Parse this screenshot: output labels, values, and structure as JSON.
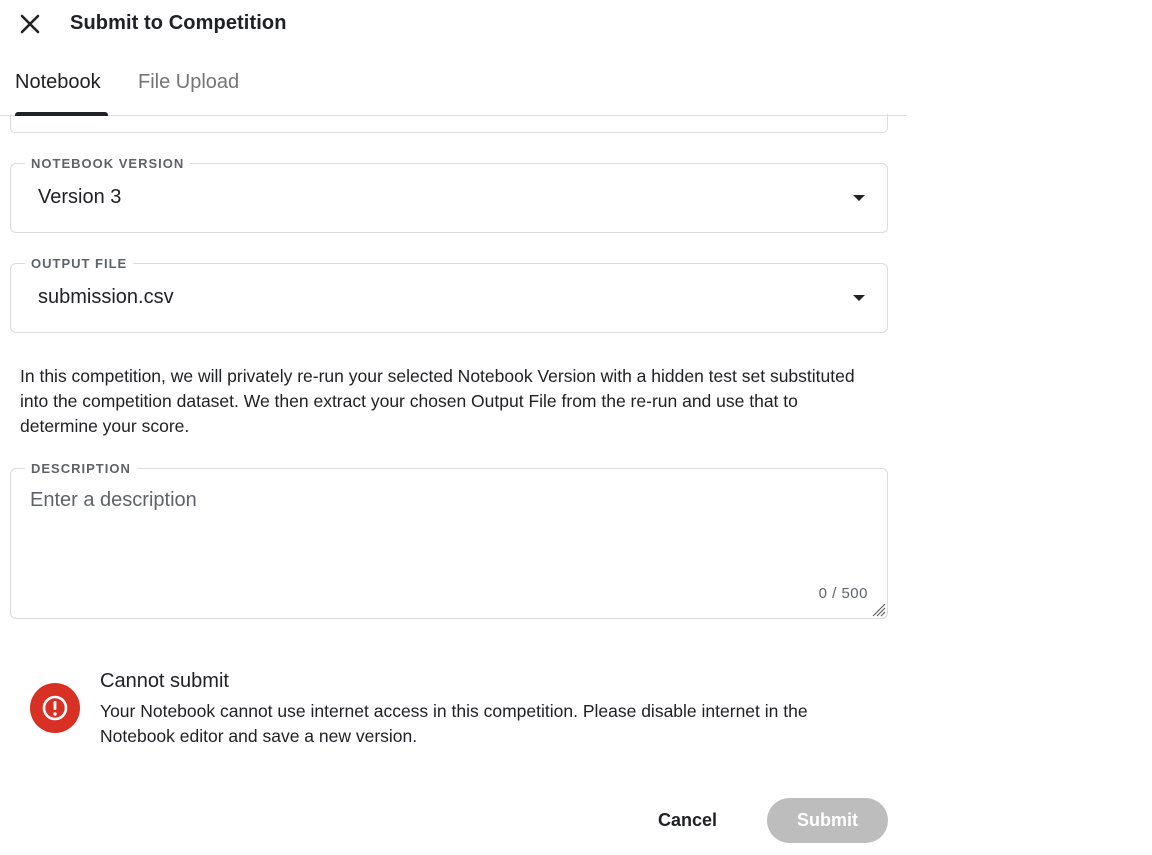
{
  "header": {
    "title": "Submit to Competition",
    "close_icon": "close-icon"
  },
  "tabs": [
    {
      "label": "Notebook",
      "active": true
    },
    {
      "label": "File Upload",
      "active": false
    }
  ],
  "form": {
    "notebook_version": {
      "label": "NOTEBOOK VERSION",
      "value": "Version 3"
    },
    "output_file": {
      "label": "OUTPUT FILE",
      "value": "submission.csv"
    },
    "info_text": "In this competition, we will privately re-run your selected Notebook Version with a hidden test set substituted into the competition dataset. We then extract your chosen Output File from the re-run and use that to determine your score.",
    "description": {
      "label": "DESCRIPTION",
      "placeholder": "Enter a description",
      "value": "",
      "char_count": "0 / 500"
    }
  },
  "error": {
    "icon": "error-icon",
    "title": "Cannot submit",
    "message": "Your Notebook cannot use internet access in this competition. Please disable internet in the Notebook editor and save a new version."
  },
  "actions": {
    "cancel_label": "Cancel",
    "submit_label": "Submit",
    "submit_disabled": true
  },
  "colors": {
    "error_red": "#d93025",
    "disabled_button": "#bdbdbd",
    "text_primary": "#202124",
    "text_secondary": "#5f6368",
    "border": "#dadce0"
  }
}
